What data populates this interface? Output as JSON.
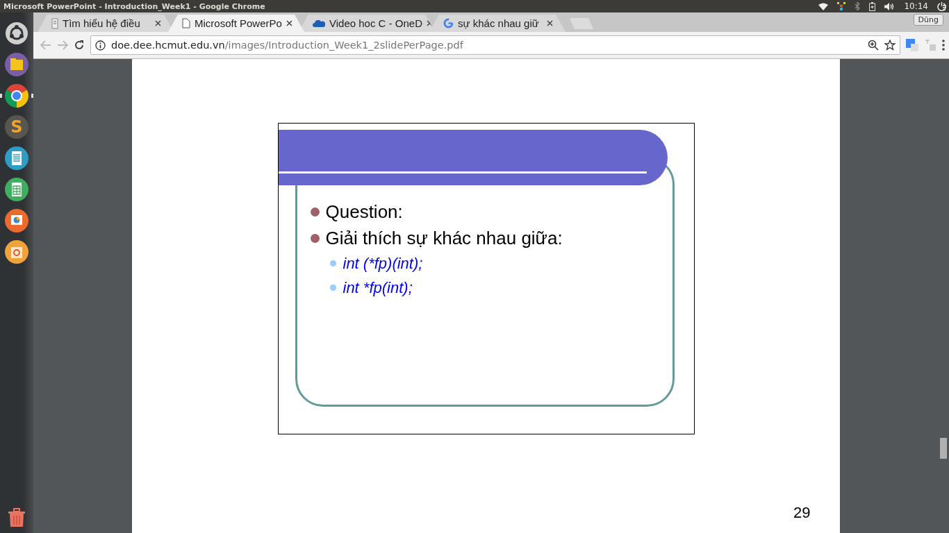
{
  "window": {
    "title": "Microsoft PowerPoint - Introduction_Week1 - Google Chrome"
  },
  "panel": {
    "clock": "10:14"
  },
  "launcher": [
    {
      "kind": "dash"
    },
    {
      "kind": "files"
    },
    {
      "kind": "browser",
      "running": true
    },
    {
      "kind": "editor",
      "glyph": "S"
    },
    {
      "kind": "writer"
    },
    {
      "kind": "calc"
    },
    {
      "kind": "impress"
    },
    {
      "kind": "store"
    },
    {
      "kind": "trash"
    }
  ],
  "tabs": [
    {
      "label": "Tìm hiểu hệ điều",
      "kind": "file",
      "selected": false
    },
    {
      "label": "Microsoft PowerPo",
      "kind": "page",
      "selected": true
    },
    {
      "label": "Video hoc C - OneD",
      "kind": "cloud",
      "selected": false
    },
    {
      "label": "sự khác nhau giữ",
      "kind": "g",
      "selected": false
    }
  ],
  "profile": {
    "name": "Dũng"
  },
  "address": {
    "host": "doe.dee.hcmut.edu.vn",
    "path": "/images/Introduction_Week1_2slidePerPage.pdf"
  },
  "slide": {
    "bullets": [
      {
        "text": "Question:"
      },
      {
        "text": "Giải thích sự khác nhau giữa:",
        "children": [
          {
            "text": "int (*fp)(int);"
          },
          {
            "text": "int *fp(int);"
          }
        ]
      }
    ],
    "page_number": "29"
  }
}
